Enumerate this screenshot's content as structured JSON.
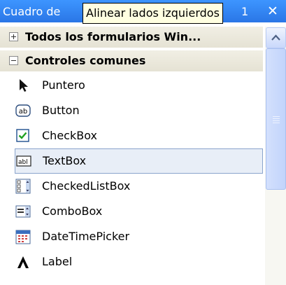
{
  "window": {
    "title": "Cuadro de",
    "title_trailing_fragment": "1",
    "close_glyph": "✕"
  },
  "tooltip": {
    "text": "Alinear lados izquierdos"
  },
  "categories": [
    {
      "label": "Todos los formularios Win...",
      "expanded": false
    },
    {
      "label": "Controles comunes",
      "expanded": true
    }
  ],
  "items": [
    {
      "label": "Puntero",
      "icon": "pointer-icon"
    },
    {
      "label": "Button",
      "icon": "button-icon"
    },
    {
      "label": "CheckBox",
      "icon": "checkbox-icon"
    },
    {
      "label": "TextBox",
      "icon": "textbox-icon",
      "selected": true
    },
    {
      "label": "CheckedListBox",
      "icon": "checkedlistbox-icon"
    },
    {
      "label": "ComboBox",
      "icon": "combobox-icon"
    },
    {
      "label": "DateTimePicker",
      "icon": "datetimepicker-icon"
    },
    {
      "label": "Label",
      "icon": "label-icon"
    }
  ],
  "colors": {
    "titlebar": "#2a76e6",
    "tooltip_bg": "#ffffe1",
    "selection_bg": "#e8eef7",
    "selection_border": "#8aa4cc",
    "scrollbar": "#c9d8fb"
  }
}
